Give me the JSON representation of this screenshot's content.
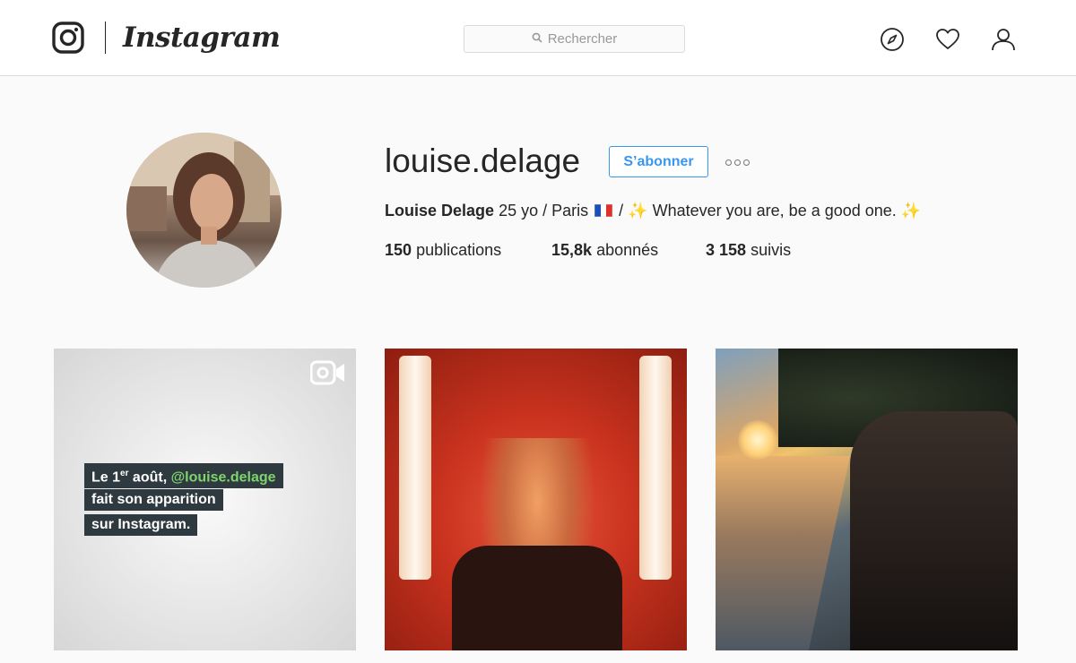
{
  "header": {
    "wordmark": "Instagram",
    "search_placeholder": "Rechercher",
    "icons": [
      "camera-logo-icon",
      "compass-icon",
      "heart-icon",
      "user-icon"
    ]
  },
  "profile": {
    "username": "louise.delage",
    "follow_label": "S’abonner",
    "bio_name": "Louise Delage",
    "bio_part1": "25 yo / Paris",
    "bio_slash": "/",
    "bio_part2": "Whatever you are, be a good one.",
    "sparkle": "✨",
    "stats": [
      {
        "value": "150",
        "label": "publications"
      },
      {
        "value": "15,8k",
        "label": "abonnés"
      },
      {
        "value": "3 158",
        "label": "suivis"
      }
    ]
  },
  "posts": {
    "first": {
      "line1_prefix": "Le 1",
      "line1_sup": "er",
      "line1_mid": " août, ",
      "line1_handle": "@louise.delage",
      "line2": "fait son apparition",
      "line3": "sur Instagram.",
      "icon": "video-camera-icon"
    }
  },
  "colors": {
    "accent": "#3897f0",
    "handle_green": "#7fd46b",
    "caption_bg": "#2e3a40"
  }
}
